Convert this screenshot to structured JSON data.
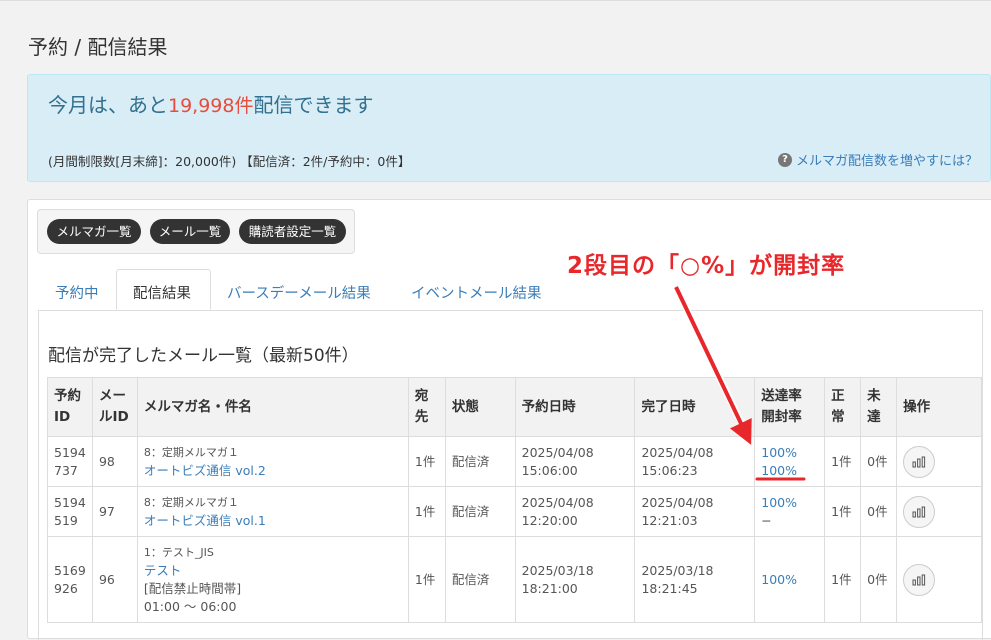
{
  "page": {
    "title": "予約 / 配信結果"
  },
  "quota": {
    "prefix": "今月は、あと",
    "remaining": "19,998件",
    "suffix": "配信できます",
    "detail": "(月間制限数[月末締]：20,000件) 【配信済：2件/予約中：0件】",
    "help_link": "メルマガ配信数を増やすには？"
  },
  "nav_buttons": [
    "メルマガ一覧",
    "メール一覧",
    "購読者設定一覧"
  ],
  "tabs": [
    "予約中",
    "配信結果",
    "バースデーメール結果",
    "イベントメール結果"
  ],
  "active_tab": "配信結果",
  "section_title": "配信が完了したメール一覧（最新50件）",
  "table": {
    "headers": {
      "reserve_id": [
        "予約",
        "ID"
      ],
      "mail_id": [
        "メー",
        "ルID"
      ],
      "magazine": "メルマガ名・件名",
      "recipients": [
        "宛",
        "先"
      ],
      "status": "状態",
      "reserved_at": "予約日時",
      "completed_at": "完了日時",
      "rates": [
        "送達率",
        "開封率"
      ],
      "normal": [
        "正",
        "常"
      ],
      "undelivered": [
        "未",
        "達"
      ],
      "operations": "操作"
    },
    "rows": [
      {
        "reserve_id": [
          "5194",
          "737"
        ],
        "mail_id": "98",
        "magazine": "8：定期メルマガ１",
        "subject": "オートビズ通信 vol.2",
        "note": [],
        "recipients": "1件",
        "status": "配信済",
        "reserved_at": [
          "2025/04/08",
          "15:06:00"
        ],
        "completed_at": [
          "2025/04/08",
          "15:06:23"
        ],
        "delivery_rate": "100%",
        "open_rate": "100%",
        "normal": "1件",
        "undelivered": "0件"
      },
      {
        "reserve_id": [
          "5194",
          "519"
        ],
        "mail_id": "97",
        "magazine": "8：定期メルマガ１",
        "subject": "オートビズ通信 vol.1",
        "note": [],
        "recipients": "1件",
        "status": "配信済",
        "reserved_at": [
          "2025/04/08",
          "12:20:00"
        ],
        "completed_at": [
          "2025/04/08",
          "12:21:03"
        ],
        "delivery_rate": "100%",
        "open_rate": "−",
        "normal": "1件",
        "undelivered": "0件"
      },
      {
        "reserve_id": [
          "5169",
          "926"
        ],
        "mail_id": "96",
        "magazine": "1：テスト_JIS",
        "subject": "テスト",
        "note": [
          "[配信禁止時間帯]",
          "01:00 〜 06:00"
        ],
        "recipients": "1件",
        "status": "配信済",
        "reserved_at": [
          "2025/03/18",
          "18:21:00"
        ],
        "completed_at": [
          "2025/03/18",
          "18:21:45"
        ],
        "delivery_rate": "100%",
        "open_rate": "",
        "normal": "1件",
        "undelivered": "0件"
      }
    ]
  },
  "annotation": {
    "text": "2段目の「○%」が開封率"
  },
  "colors": {
    "accent": "#3a7db8",
    "highlight": "#e74c3c",
    "annotation": "#e8272b",
    "alert_bg": "#d9edf7"
  },
  "icons": {
    "help": "question-circle-icon",
    "operation": "bar-chart-icon"
  }
}
